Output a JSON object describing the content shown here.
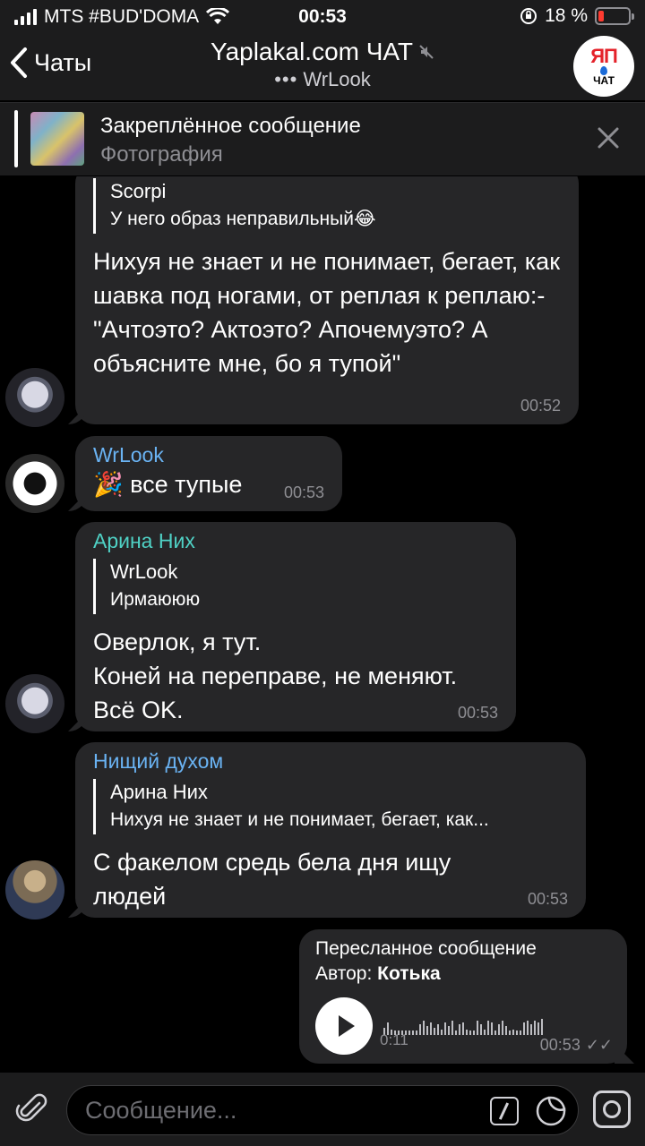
{
  "status_bar": {
    "carrier": "MTS #BUD'DOMA",
    "time": "00:53",
    "battery": "18 %",
    "battery_level": 0.18
  },
  "header": {
    "back_label": "Чаты",
    "title": "Yaplakal.com ЧАТ",
    "subtitle_dots": "•••",
    "typing_user": "WrLook",
    "avatar_logo_text": "ЯП",
    "avatar_sub_text": "ЧАТ"
  },
  "pinned": {
    "title": "Закреплённое сообщение",
    "subtitle": "Фотография"
  },
  "messages": [
    {
      "reply_name": "Scorpi",
      "reply_text": "У него образ неправильный😂",
      "text": "Нихуя не знает и не понимает, бегает, как шавка под ногами, от реплая к реплаю:-\"Ачтоэто? Актоэто? Апочемуэто? А объясните мне, бо я тупой\"",
      "time": "00:52"
    },
    {
      "sender": "WrLook",
      "sender_color": "#6ab3f3",
      "text": "🎉 все тупые",
      "time": "00:53"
    },
    {
      "sender": "Арина Них",
      "sender_color": "#4fd1c5",
      "reply_name": "WrLook",
      "reply_text": "Ирмаююю",
      "lines": [
        "Оверлок, я тут.",
        "Коней на переправе, не меняют.",
        "Всё OK."
      ],
      "time": "00:53"
    },
    {
      "sender": "Нищий духом",
      "sender_color": "#6ab3f3",
      "reply_name": "Арина Них",
      "reply_text": "Нихуя не знает и не понимает, бегает, как...",
      "text": "С факелом средь бела дня ищу людей",
      "time": "00:53"
    },
    {
      "forwarded_label": "Пересланное сообщение",
      "author_label": "Автор:",
      "author_name": "Котька",
      "duration": "0:11",
      "time": "00:53",
      "status": "✓✓"
    }
  ],
  "input": {
    "placeholder": "Сообщение..."
  }
}
